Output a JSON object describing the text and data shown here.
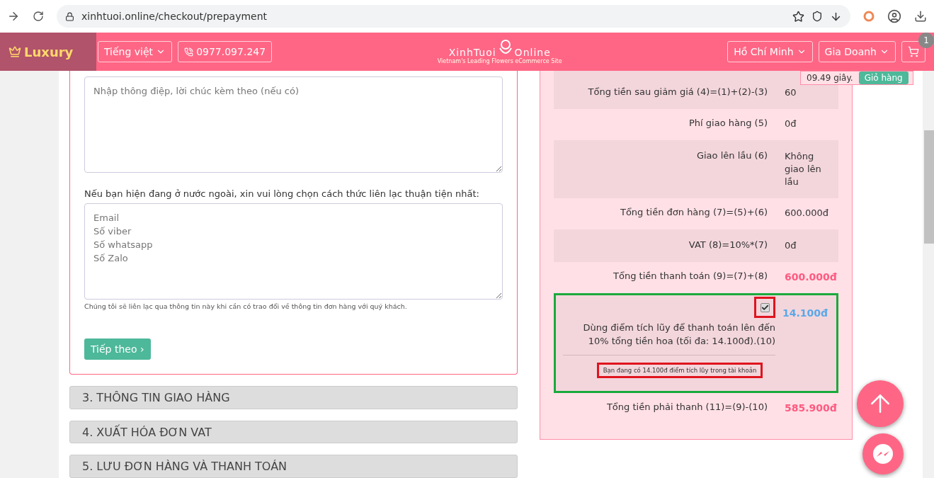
{
  "browser": {
    "url": "xinhtuoi.online/checkout/prepayment"
  },
  "header": {
    "brand": "Luxury",
    "language": "Tiếng việt",
    "phone": "0977.097.247",
    "logo": "XinhTuoi",
    "logo_suffix": "Online",
    "tagline": "Vietnam's Leading Flowers eCommerce Site",
    "city": "Hồ Chí Minh",
    "district": "Gia Doanh",
    "cart_count": "1"
  },
  "cart_popup": {
    "text": "09.49 giây.",
    "button": "Giỏ hàng"
  },
  "form": {
    "message_field": {
      "placeholder": "Nhập thông điệp, lời chúc kèm theo (nếu có)"
    },
    "contact_label": "Nếu bạn hiện đang ở nước ngoài, xin vui lòng chọn cách thức liên lạc thuận tiện nhất:",
    "contact_field": {
      "placeholder": "Email\nSố viber\nSố whatsapp\nSố Zalo"
    },
    "hint": "Chúng tôi sẽ liên lạc qua thông tin này khi cần có trao đổi về thông tin đơn hàng với quý khách.",
    "next_button": "Tiếp theo ›"
  },
  "sections": [
    {
      "title": "3. THÔNG TIN GIAO HÀNG"
    },
    {
      "title": "4. XUẤT HÓA ĐƠN VAT"
    },
    {
      "title": "5. LƯU ĐƠN HÀNG VÀ THANH TOÁN"
    }
  ],
  "summary": {
    "rows": [
      {
        "label": "Tổng tiền sau giảm giá (4)=(1)+(2)-(3)",
        "value": "60",
        "shaded": true,
        "kind": "plain"
      },
      {
        "label": "Phí giao hàng (5)",
        "value": "0đ",
        "shaded": false,
        "kind": "plain"
      },
      {
        "label": "Giao lên lầu (6)",
        "value": "Không giao lên lầu",
        "shaded": true,
        "kind": "plain"
      },
      {
        "label": "Tổng tiền đơn hàng (7)=(5)+(6)",
        "value": "600.000đ",
        "shaded": false,
        "kind": "plain"
      },
      {
        "label": "VAT (8)=10%*(7)",
        "value": "0đ",
        "shaded": true,
        "kind": "plain"
      },
      {
        "label": "Tổng tiền thanh toán (9)=(7)+(8)",
        "value": "600.000đ",
        "shaded": false,
        "kind": "total"
      }
    ],
    "points": {
      "checked": true,
      "amount": "14.100đ",
      "label": "Dùng điểm tích lũy để thanh toán lên đến 10% tổng tiền hoa (tối đa: 14.100đ).(10)",
      "note": "Bạn đang có 14.100đ điểm tích lũy trong tài khoản"
    },
    "final": {
      "label": "Tổng tiền phải thanh (11)=(9)-(10)",
      "value": "585.900đ"
    }
  }
}
